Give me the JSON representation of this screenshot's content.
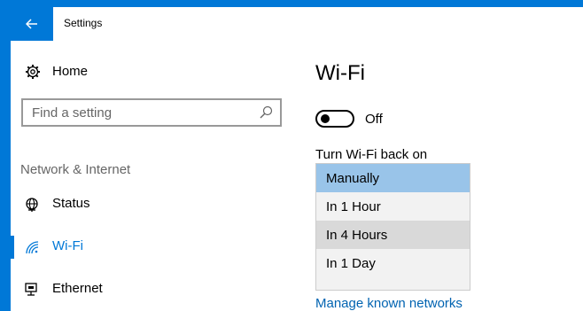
{
  "window": {
    "title": "Settings",
    "back_icon": "arrow-left-icon"
  },
  "sidebar": {
    "home": {
      "label": "Home",
      "icon": "gear-icon"
    },
    "search": {
      "placeholder": "Find a setting",
      "icon": "search-icon"
    },
    "section_header": "Network & Internet",
    "items": [
      {
        "label": "Status",
        "icon": "globe-icon",
        "active": false
      },
      {
        "label": "Wi-Fi",
        "icon": "wifi-icon",
        "active": true
      },
      {
        "label": "Ethernet",
        "icon": "ethernet-icon",
        "active": false
      }
    ]
  },
  "main": {
    "title": "Wi-Fi",
    "toggle": {
      "state_label": "Off",
      "on": false
    },
    "dropdown": {
      "label": "Turn Wi-Fi back on",
      "options": [
        {
          "label": "Manually",
          "state": "selected"
        },
        {
          "label": "In 1 Hour",
          "state": "normal"
        },
        {
          "label": "In 4 Hours",
          "state": "hover"
        },
        {
          "label": "In 1 Day",
          "state": "normal"
        }
      ]
    },
    "link": "Manage known networks"
  },
  "colors": {
    "accent": "#0078d7",
    "selected": "#99c4e9",
    "hover": "#d9d9d9",
    "link": "#0063b1"
  }
}
